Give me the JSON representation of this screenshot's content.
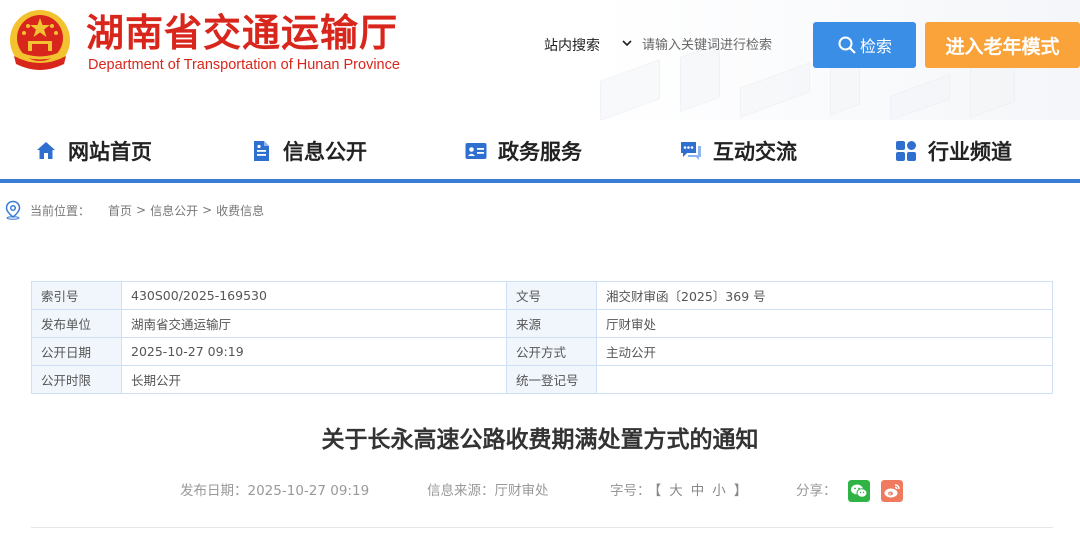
{
  "header": {
    "title": "湖南省交通运输厅",
    "subtitle": "Department of Transportation of Hunan Province",
    "search_scope": "站内搜索",
    "search_placeholder": "请输入关键词进行检索",
    "search_button": "检索",
    "elder_mode_button": "进入老年模式",
    "colors": {
      "brand_red": "#d9261c",
      "search_blue": "#3a8ee6",
      "elder_orange": "#f9a33a"
    }
  },
  "nav": {
    "items": [
      {
        "label": "网站首页",
        "icon": "home-icon"
      },
      {
        "label": "信息公开",
        "icon": "document-icon"
      },
      {
        "label": "政务服务",
        "icon": "id-card-icon"
      },
      {
        "label": "互动交流",
        "icon": "chat-icon"
      },
      {
        "label": "行业频道",
        "icon": "grid-icon"
      }
    ],
    "accent": "#3a7bd5"
  },
  "breadcrumb": {
    "prefix": "当前位置：",
    "items": [
      "首页",
      "信息公开",
      "收费信息"
    ],
    "separator": ">"
  },
  "meta": {
    "rows": [
      {
        "k1": "索引号",
        "v1": "430S00/2025-169530",
        "k2": "文号",
        "v2": "湘交财审函〔2025〕369 号"
      },
      {
        "k1": "发布单位",
        "v1": "湖南省交通运输厅",
        "k2": "来源",
        "v2": "厅财审处"
      },
      {
        "k1": "公开日期",
        "v1": "2025-10-27 09:19",
        "k2": "公开方式",
        "v2": "主动公开"
      },
      {
        "k1": "公开时限",
        "v1": "长期公开",
        "k2": "统一登记号",
        "v2": ""
      }
    ]
  },
  "article": {
    "title": "关于长永高速公路收费期满处置方式的通知",
    "publish_label": "发布日期：",
    "publish_date": "2025-10-27 09:19",
    "source_label": "信息来源：",
    "source": "厅财审处",
    "size_label": "字号：",
    "size_open": "【",
    "size_large": "大",
    "size_medium": "中",
    "size_small": "小",
    "size_close": "】",
    "share_label": "分享：",
    "share_icons": [
      "wechat-icon",
      "weibo-icon"
    ]
  }
}
